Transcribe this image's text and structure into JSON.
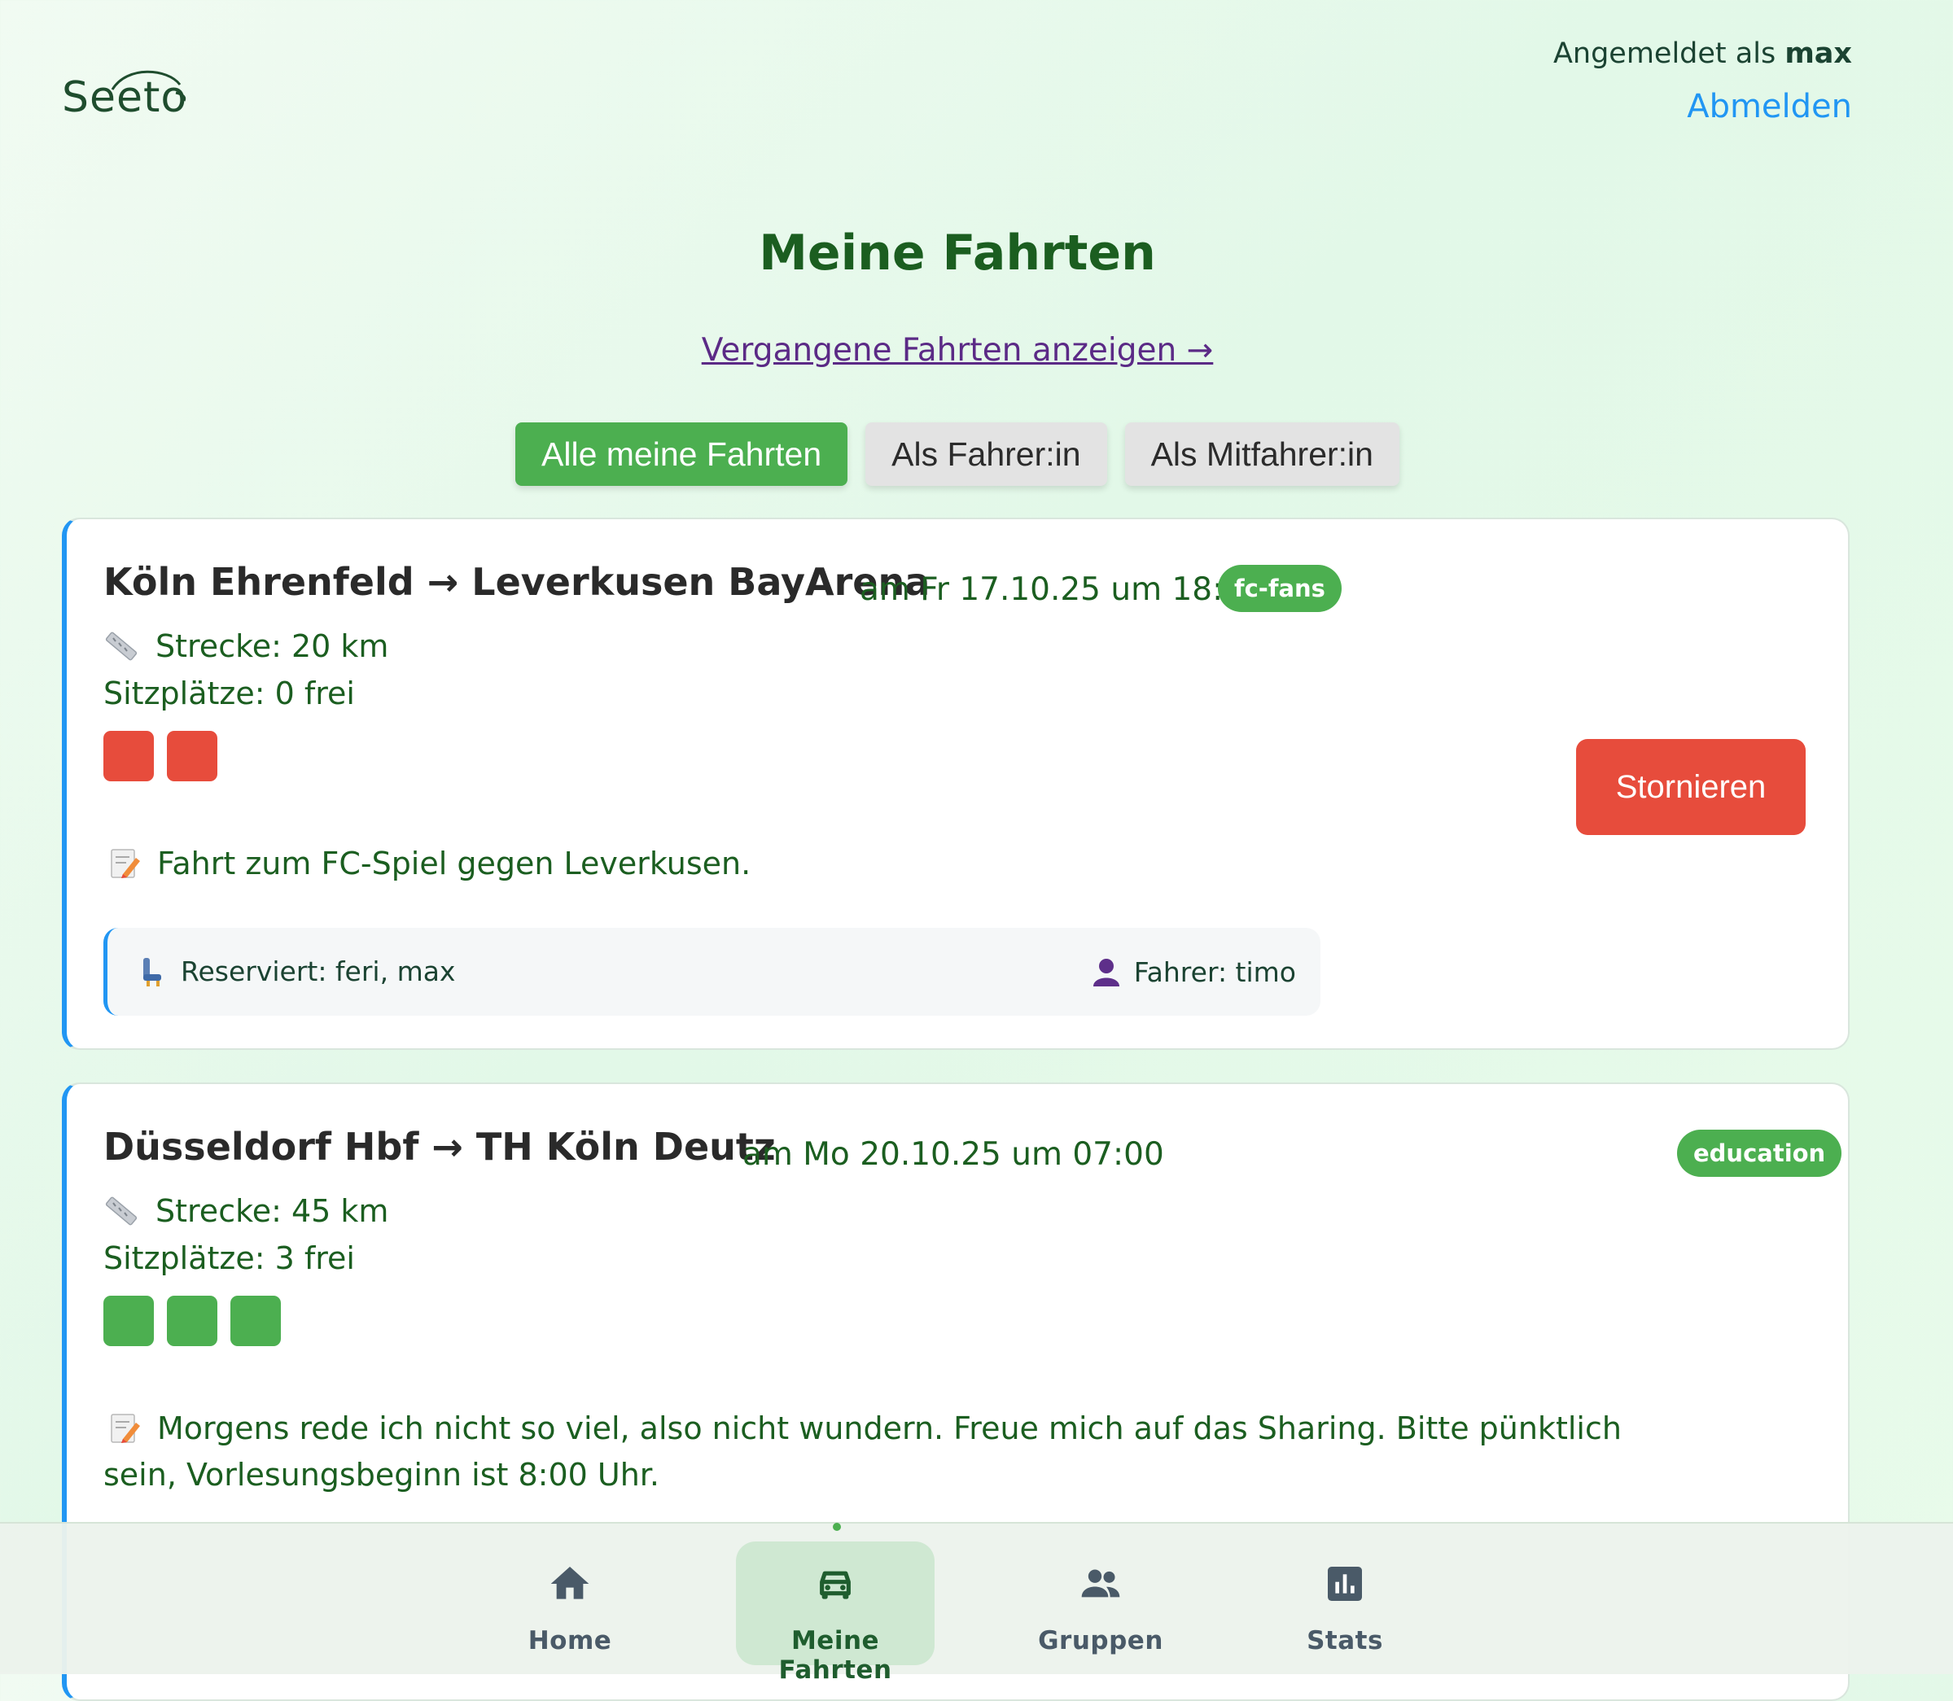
{
  "header": {
    "logo_text": "Seeto",
    "logged_in_prefix": "Angemeldet als",
    "username": "max",
    "logout_label": "Abmelden"
  },
  "page": {
    "title": "Meine Fahrten",
    "past_link": "Vergangene Fahrten anzeigen →"
  },
  "filters": [
    {
      "label": "Alle meine Fahrten",
      "active": true
    },
    {
      "label": "Als Fahrer:in",
      "active": false
    },
    {
      "label": "Als Mitfahrer:in",
      "active": false
    }
  ],
  "rides": [
    {
      "route": "Köln Ehrenfeld → Leverkusen BayArena",
      "date": "am Fr 17.10.25 um 18:30",
      "group": "fc-fans",
      "distance": "Strecke: 20 km",
      "seats_text": "Sitzplätze: 0 frei",
      "seats": [
        "taken",
        "taken"
      ],
      "note": "Fahrt zum FC-Spiel gegen Leverkusen.",
      "action_label": "Stornieren",
      "reserved": "Reserviert: feri, max",
      "driver": "Fahrer: timo"
    },
    {
      "route": "Düsseldorf Hbf → TH Köln Deutz",
      "date": "am Mo 20.10.25 um 07:00",
      "group": "education",
      "distance": "Strecke: 45 km",
      "seats_text": "Sitzplätze: 3 frei",
      "seats": [
        "free",
        "free",
        "free"
      ],
      "note": "Morgens rede ich nicht so viel, also nicht wundern. Freue mich auf das Sharing. Bitte pünktlich sein, Vorlesungsbeginn ist 8:00 Uhr."
    }
  ],
  "nav": [
    {
      "label": "Home",
      "icon": "home-icon",
      "active": false
    },
    {
      "label": "Meine Fahrten",
      "icon": "car-icon",
      "active": true
    },
    {
      "label": "Gruppen",
      "icon": "group-icon",
      "active": false
    },
    {
      "label": "Stats",
      "icon": "chart-icon",
      "active": false
    }
  ],
  "colors": {
    "accent": "#4caf50",
    "danger": "#e74c3c",
    "link": "#2196f3",
    "title": "#1b5e20"
  }
}
